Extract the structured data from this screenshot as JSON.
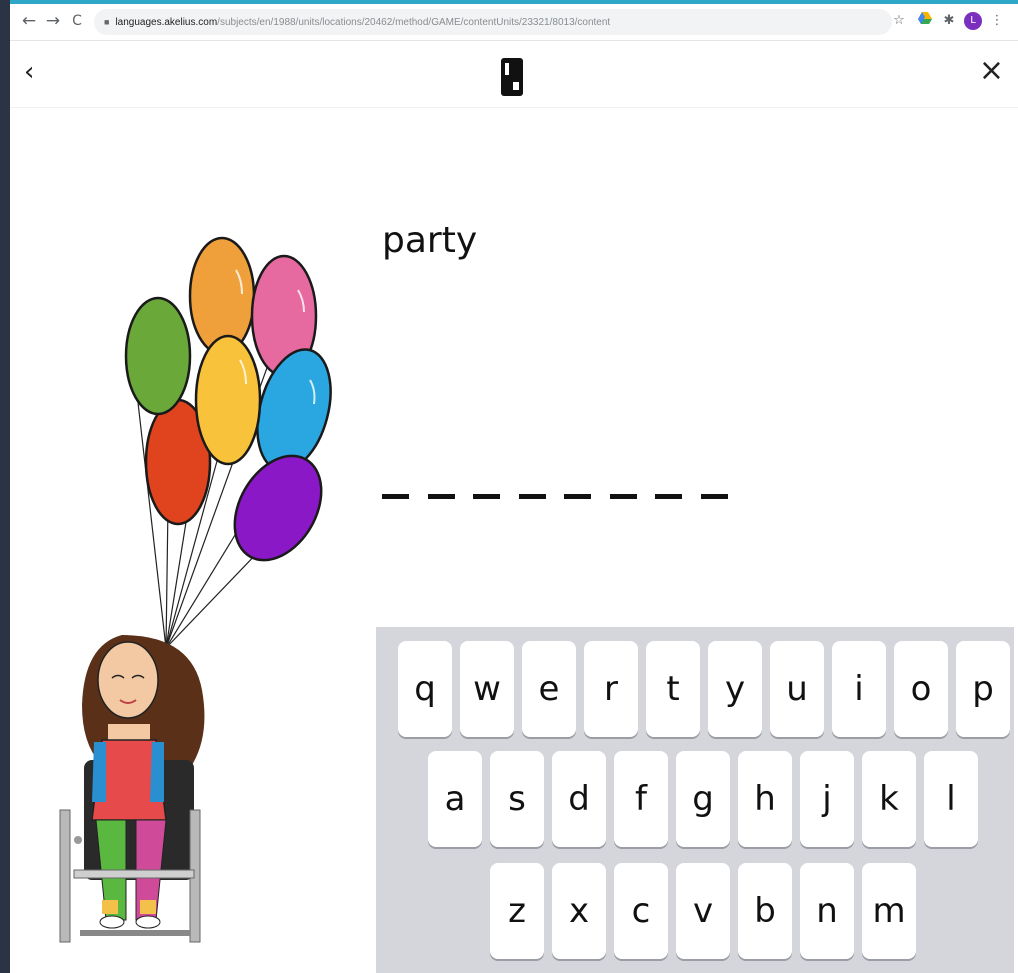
{
  "browser": {
    "url_host": "languages.akelius.com",
    "url_path": "/subjects/en/1988/units/locations/20462/method/GAME/contentUnits/23321/8013/content",
    "back_icon": "←",
    "forward_icon": "→",
    "reload_icon": "C",
    "star_icon": "☆",
    "extensions_icon": "✱",
    "menu_icon": "⋮",
    "profile_initial": "L"
  },
  "header": {
    "back_icon": "‹",
    "close_icon": "×"
  },
  "exercise": {
    "word": "party",
    "blank_count": 8
  },
  "keyboard": {
    "rows": [
      [
        "q",
        "w",
        "e",
        "r",
        "t",
        "y",
        "u",
        "i",
        "o",
        "p"
      ],
      [
        "a",
        "s",
        "d",
        "f",
        "g",
        "h",
        "j",
        "k",
        "l"
      ],
      [
        "z",
        "x",
        "c",
        "v",
        "b",
        "n",
        "m"
      ]
    ]
  },
  "colors": {
    "balloon_green": "#6aa83a",
    "balloon_orange": "#f0a03a",
    "balloon_pink": "#e66aa0",
    "balloon_yellow": "#f8c23a",
    "balloon_blue": "#2aa6e0",
    "balloon_red": "#e0441e",
    "balloon_purple": "#8a18c6"
  }
}
